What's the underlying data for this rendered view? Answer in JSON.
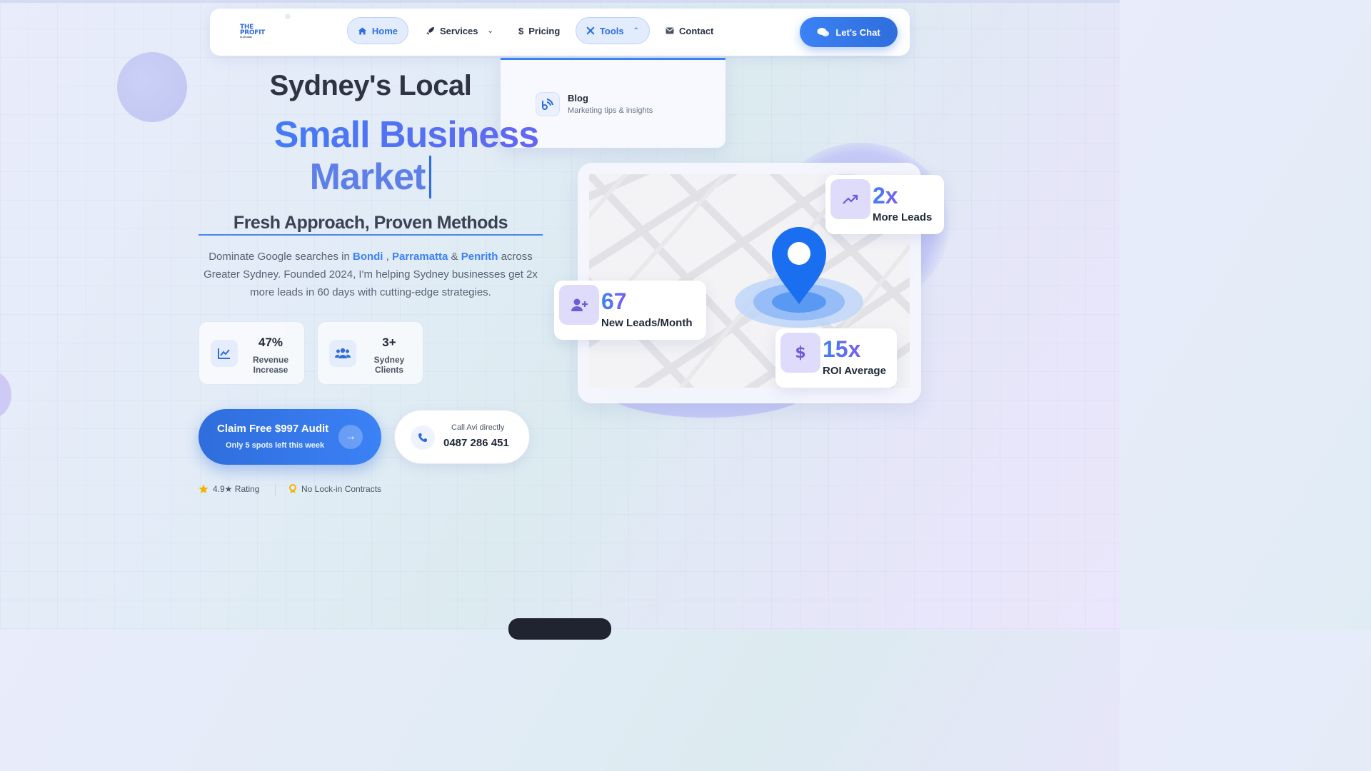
{
  "nav": {
    "logo_line1": "THE",
    "logo_line2": "PROFIT",
    "logo_line3": "PLATFORM",
    "items": [
      {
        "label": "Home"
      },
      {
        "label": "Services"
      },
      {
        "label": "Pricing"
      },
      {
        "label": "Tools"
      },
      {
        "label": "Contact"
      }
    ],
    "cta_label": "Let's Chat"
  },
  "tools_dropdown": {
    "item_title": "Blog",
    "item_desc": "Marketing tips & insights"
  },
  "hero": {
    "line1": "Sydney's Local",
    "line2": "Small Business",
    "line3": "Market",
    "subheading": "Fresh Approach, Proven Methods",
    "desc_prefix": "Dominate Google searches in ",
    "loc1": "Bondi",
    "sep1": " , ",
    "loc2": "Parramatta",
    "sep2": " & ",
    "loc3": "Penrith",
    "desc_suffix": " across Greater Sydney. Founded 2024, I'm helping Sydney businesses get 2x more leads in 60 days with cutting-edge strategies."
  },
  "stats": [
    {
      "value": "47%",
      "label": "Revenue Increase"
    },
    {
      "value": "3+",
      "label": "Sydney Clients"
    }
  ],
  "cta": {
    "main": "Claim Free $997 Audit",
    "sub": "Only 5 spots left this week"
  },
  "call": {
    "label": "Call Avi directly",
    "number": "0487 286 451"
  },
  "trust": {
    "rating": "4.9★ Rating",
    "contracts": "No Lock-in Contracts"
  },
  "metrics": {
    "leads_value": "2x",
    "leads_label": "More Leads",
    "month_value": "67",
    "month_label": "New Leads/Month",
    "roi_value": "15x",
    "roi_label": "ROI Average"
  },
  "colors": {
    "primary": "#3b82f6",
    "accent": "#6366f1",
    "text": "#1f2937"
  }
}
